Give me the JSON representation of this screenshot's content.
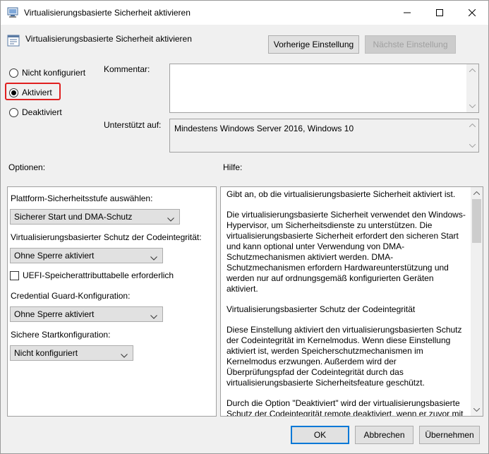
{
  "window": {
    "title": "Virtualisierungsbasierte Sicherheit aktivieren",
    "icons": {
      "app": "policy-editor-icon",
      "minimize": "minimize-icon",
      "maximize": "maximize-icon",
      "close": "close-icon"
    }
  },
  "header": {
    "policy_title": "Virtualisierungsbasierte Sicherheit aktivieren",
    "prev_button": "Vorherige Einstellung",
    "next_button": "Nächste Einstellung"
  },
  "state": {
    "options": [
      "Nicht konfiguriert",
      "Aktiviert",
      "Deaktiviert"
    ],
    "selected": "Aktiviert"
  },
  "comment": {
    "label": "Kommentar:",
    "value": ""
  },
  "supported": {
    "label": "Unterstützt auf:",
    "value": "Mindestens Windows Server 2016, Windows 10"
  },
  "options_section": {
    "label": "Optionen:",
    "platform_label": "Plattform-Sicherheitsstufe auswählen:",
    "platform_value": "Sicherer Start und DMA-Schutz",
    "codeintegrity_label": "Virtualisierungsbasierter Schutz der Codeintegrität:",
    "codeintegrity_value": "Ohne Sperre aktiviert",
    "uefi_label": "UEFI-Speicherattributtabelle erforderlich",
    "credguard_label": "Credential Guard-Konfiguration:",
    "credguard_value": "Ohne Sperre aktiviert",
    "securelaunch_label": "Sichere Startkonfiguration:",
    "securelaunch_value": "Nicht konfiguriert"
  },
  "help_section": {
    "label": "Hilfe:",
    "paragraphs": [
      "Gibt an, ob die virtualisierungsbasierte Sicherheit aktiviert ist.",
      "Die virtualisierungsbasierte Sicherheit verwendet den Windows-Hypervisor, um Sicherheitsdienste zu unterstützen. Die virtualisierungsbasierte Sicherheit erfordert den sicheren Start und kann optional unter Verwendung von DMA-Schutzmechanismen aktiviert werden. DMA-Schutzmechanismen erfordern Hardwareunterstützung und werden nur auf ordnungsgemäß konfigurierten Geräten aktiviert.",
      "Virtualisierungsbasierter Schutz der Codeintegrität",
      "Diese Einstellung aktiviert den virtualisierungsbasierten Schutz der Codeintegrität im Kernelmodus. Wenn diese Einstellung aktiviert ist, werden Speicherschutzmechanismen im Kernelmodus erzwungen. Außerdem wird der Überprüfungspfad der Codeintegrität durch das virtualisierungsbasierte Sicherheitsfeature geschützt.",
      "Durch die Option \"Deaktiviert\" wird der virtualisierungsbasierte Schutz der Codeintegrität remote deaktiviert, wenn er zuvor mit der Option \"Ohne Sperre aktiviert\" aktiviert wurde."
    ]
  },
  "footer": {
    "ok": "OK",
    "cancel": "Abbrechen",
    "apply": "Übernehmen"
  },
  "colors": {
    "highlight": "#e02020",
    "focus": "#0078d7"
  }
}
